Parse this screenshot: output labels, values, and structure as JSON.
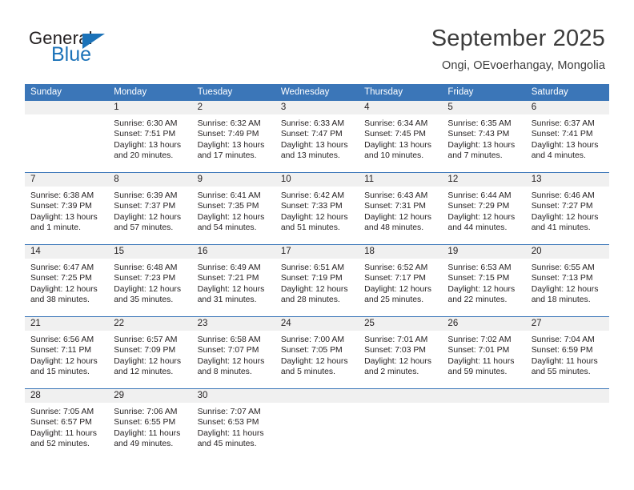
{
  "brand": {
    "word_one": "General",
    "word_two": "Blue",
    "triangle_color": "#1b72b8"
  },
  "header": {
    "title": "September 2025",
    "subtitle": "Ongi, OEvoerhangay, Mongolia",
    "accent_color": "#3b76b8",
    "date_band_color": "#f0f0f0"
  },
  "weekdays": [
    "Sunday",
    "Monday",
    "Tuesday",
    "Wednesday",
    "Thursday",
    "Friday",
    "Saturday"
  ],
  "labels": {
    "sunrise_prefix": "Sunrise:",
    "sunset_prefix": "Sunset:",
    "daylight_prefix": "Daylight:"
  },
  "weeks": [
    [
      {
        "day": "",
        "empty": true
      },
      {
        "day": "1",
        "sunrise": "Sunrise: 6:30 AM",
        "sunset": "Sunset: 7:51 PM",
        "daylight_1": "Daylight: 13 hours",
        "daylight_2": "and 20 minutes."
      },
      {
        "day": "2",
        "sunrise": "Sunrise: 6:32 AM",
        "sunset": "Sunset: 7:49 PM",
        "daylight_1": "Daylight: 13 hours",
        "daylight_2": "and 17 minutes."
      },
      {
        "day": "3",
        "sunrise": "Sunrise: 6:33 AM",
        "sunset": "Sunset: 7:47 PM",
        "daylight_1": "Daylight: 13 hours",
        "daylight_2": "and 13 minutes."
      },
      {
        "day": "4",
        "sunrise": "Sunrise: 6:34 AM",
        "sunset": "Sunset: 7:45 PM",
        "daylight_1": "Daylight: 13 hours",
        "daylight_2": "and 10 minutes."
      },
      {
        "day": "5",
        "sunrise": "Sunrise: 6:35 AM",
        "sunset": "Sunset: 7:43 PM",
        "daylight_1": "Daylight: 13 hours",
        "daylight_2": "and 7 minutes."
      },
      {
        "day": "6",
        "sunrise": "Sunrise: 6:37 AM",
        "sunset": "Sunset: 7:41 PM",
        "daylight_1": "Daylight: 13 hours",
        "daylight_2": "and 4 minutes."
      }
    ],
    [
      {
        "day": "7",
        "sunrise": "Sunrise: 6:38 AM",
        "sunset": "Sunset: 7:39 PM",
        "daylight_1": "Daylight: 13 hours",
        "daylight_2": "and 1 minute."
      },
      {
        "day": "8",
        "sunrise": "Sunrise: 6:39 AM",
        "sunset": "Sunset: 7:37 PM",
        "daylight_1": "Daylight: 12 hours",
        "daylight_2": "and 57 minutes."
      },
      {
        "day": "9",
        "sunrise": "Sunrise: 6:41 AM",
        "sunset": "Sunset: 7:35 PM",
        "daylight_1": "Daylight: 12 hours",
        "daylight_2": "and 54 minutes."
      },
      {
        "day": "10",
        "sunrise": "Sunrise: 6:42 AM",
        "sunset": "Sunset: 7:33 PM",
        "daylight_1": "Daylight: 12 hours",
        "daylight_2": "and 51 minutes."
      },
      {
        "day": "11",
        "sunrise": "Sunrise: 6:43 AM",
        "sunset": "Sunset: 7:31 PM",
        "daylight_1": "Daylight: 12 hours",
        "daylight_2": "and 48 minutes."
      },
      {
        "day": "12",
        "sunrise": "Sunrise: 6:44 AM",
        "sunset": "Sunset: 7:29 PM",
        "daylight_1": "Daylight: 12 hours",
        "daylight_2": "and 44 minutes."
      },
      {
        "day": "13",
        "sunrise": "Sunrise: 6:46 AM",
        "sunset": "Sunset: 7:27 PM",
        "daylight_1": "Daylight: 12 hours",
        "daylight_2": "and 41 minutes."
      }
    ],
    [
      {
        "day": "14",
        "sunrise": "Sunrise: 6:47 AM",
        "sunset": "Sunset: 7:25 PM",
        "daylight_1": "Daylight: 12 hours",
        "daylight_2": "and 38 minutes."
      },
      {
        "day": "15",
        "sunrise": "Sunrise: 6:48 AM",
        "sunset": "Sunset: 7:23 PM",
        "daylight_1": "Daylight: 12 hours",
        "daylight_2": "and 35 minutes."
      },
      {
        "day": "16",
        "sunrise": "Sunrise: 6:49 AM",
        "sunset": "Sunset: 7:21 PM",
        "daylight_1": "Daylight: 12 hours",
        "daylight_2": "and 31 minutes."
      },
      {
        "day": "17",
        "sunrise": "Sunrise: 6:51 AM",
        "sunset": "Sunset: 7:19 PM",
        "daylight_1": "Daylight: 12 hours",
        "daylight_2": "and 28 minutes."
      },
      {
        "day": "18",
        "sunrise": "Sunrise: 6:52 AM",
        "sunset": "Sunset: 7:17 PM",
        "daylight_1": "Daylight: 12 hours",
        "daylight_2": "and 25 minutes."
      },
      {
        "day": "19",
        "sunrise": "Sunrise: 6:53 AM",
        "sunset": "Sunset: 7:15 PM",
        "daylight_1": "Daylight: 12 hours",
        "daylight_2": "and 22 minutes."
      },
      {
        "day": "20",
        "sunrise": "Sunrise: 6:55 AM",
        "sunset": "Sunset: 7:13 PM",
        "daylight_1": "Daylight: 12 hours",
        "daylight_2": "and 18 minutes."
      }
    ],
    [
      {
        "day": "21",
        "sunrise": "Sunrise: 6:56 AM",
        "sunset": "Sunset: 7:11 PM",
        "daylight_1": "Daylight: 12 hours",
        "daylight_2": "and 15 minutes."
      },
      {
        "day": "22",
        "sunrise": "Sunrise: 6:57 AM",
        "sunset": "Sunset: 7:09 PM",
        "daylight_1": "Daylight: 12 hours",
        "daylight_2": "and 12 minutes."
      },
      {
        "day": "23",
        "sunrise": "Sunrise: 6:58 AM",
        "sunset": "Sunset: 7:07 PM",
        "daylight_1": "Daylight: 12 hours",
        "daylight_2": "and 8 minutes."
      },
      {
        "day": "24",
        "sunrise": "Sunrise: 7:00 AM",
        "sunset": "Sunset: 7:05 PM",
        "daylight_1": "Daylight: 12 hours",
        "daylight_2": "and 5 minutes."
      },
      {
        "day": "25",
        "sunrise": "Sunrise: 7:01 AM",
        "sunset": "Sunset: 7:03 PM",
        "daylight_1": "Daylight: 12 hours",
        "daylight_2": "and 2 minutes."
      },
      {
        "day": "26",
        "sunrise": "Sunrise: 7:02 AM",
        "sunset": "Sunset: 7:01 PM",
        "daylight_1": "Daylight: 11 hours",
        "daylight_2": "and 59 minutes."
      },
      {
        "day": "27",
        "sunrise": "Sunrise: 7:04 AM",
        "sunset": "Sunset: 6:59 PM",
        "daylight_1": "Daylight: 11 hours",
        "daylight_2": "and 55 minutes."
      }
    ],
    [
      {
        "day": "28",
        "sunrise": "Sunrise: 7:05 AM",
        "sunset": "Sunset: 6:57 PM",
        "daylight_1": "Daylight: 11 hours",
        "daylight_2": "and 52 minutes."
      },
      {
        "day": "29",
        "sunrise": "Sunrise: 7:06 AM",
        "sunset": "Sunset: 6:55 PM",
        "daylight_1": "Daylight: 11 hours",
        "daylight_2": "and 49 minutes."
      },
      {
        "day": "30",
        "sunrise": "Sunrise: 7:07 AM",
        "sunset": "Sunset: 6:53 PM",
        "daylight_1": "Daylight: 11 hours",
        "daylight_2": "and 45 minutes."
      },
      {
        "day": "",
        "empty": true
      },
      {
        "day": "",
        "empty": true
      },
      {
        "day": "",
        "empty": true
      },
      {
        "day": "",
        "empty": true
      }
    ]
  ]
}
